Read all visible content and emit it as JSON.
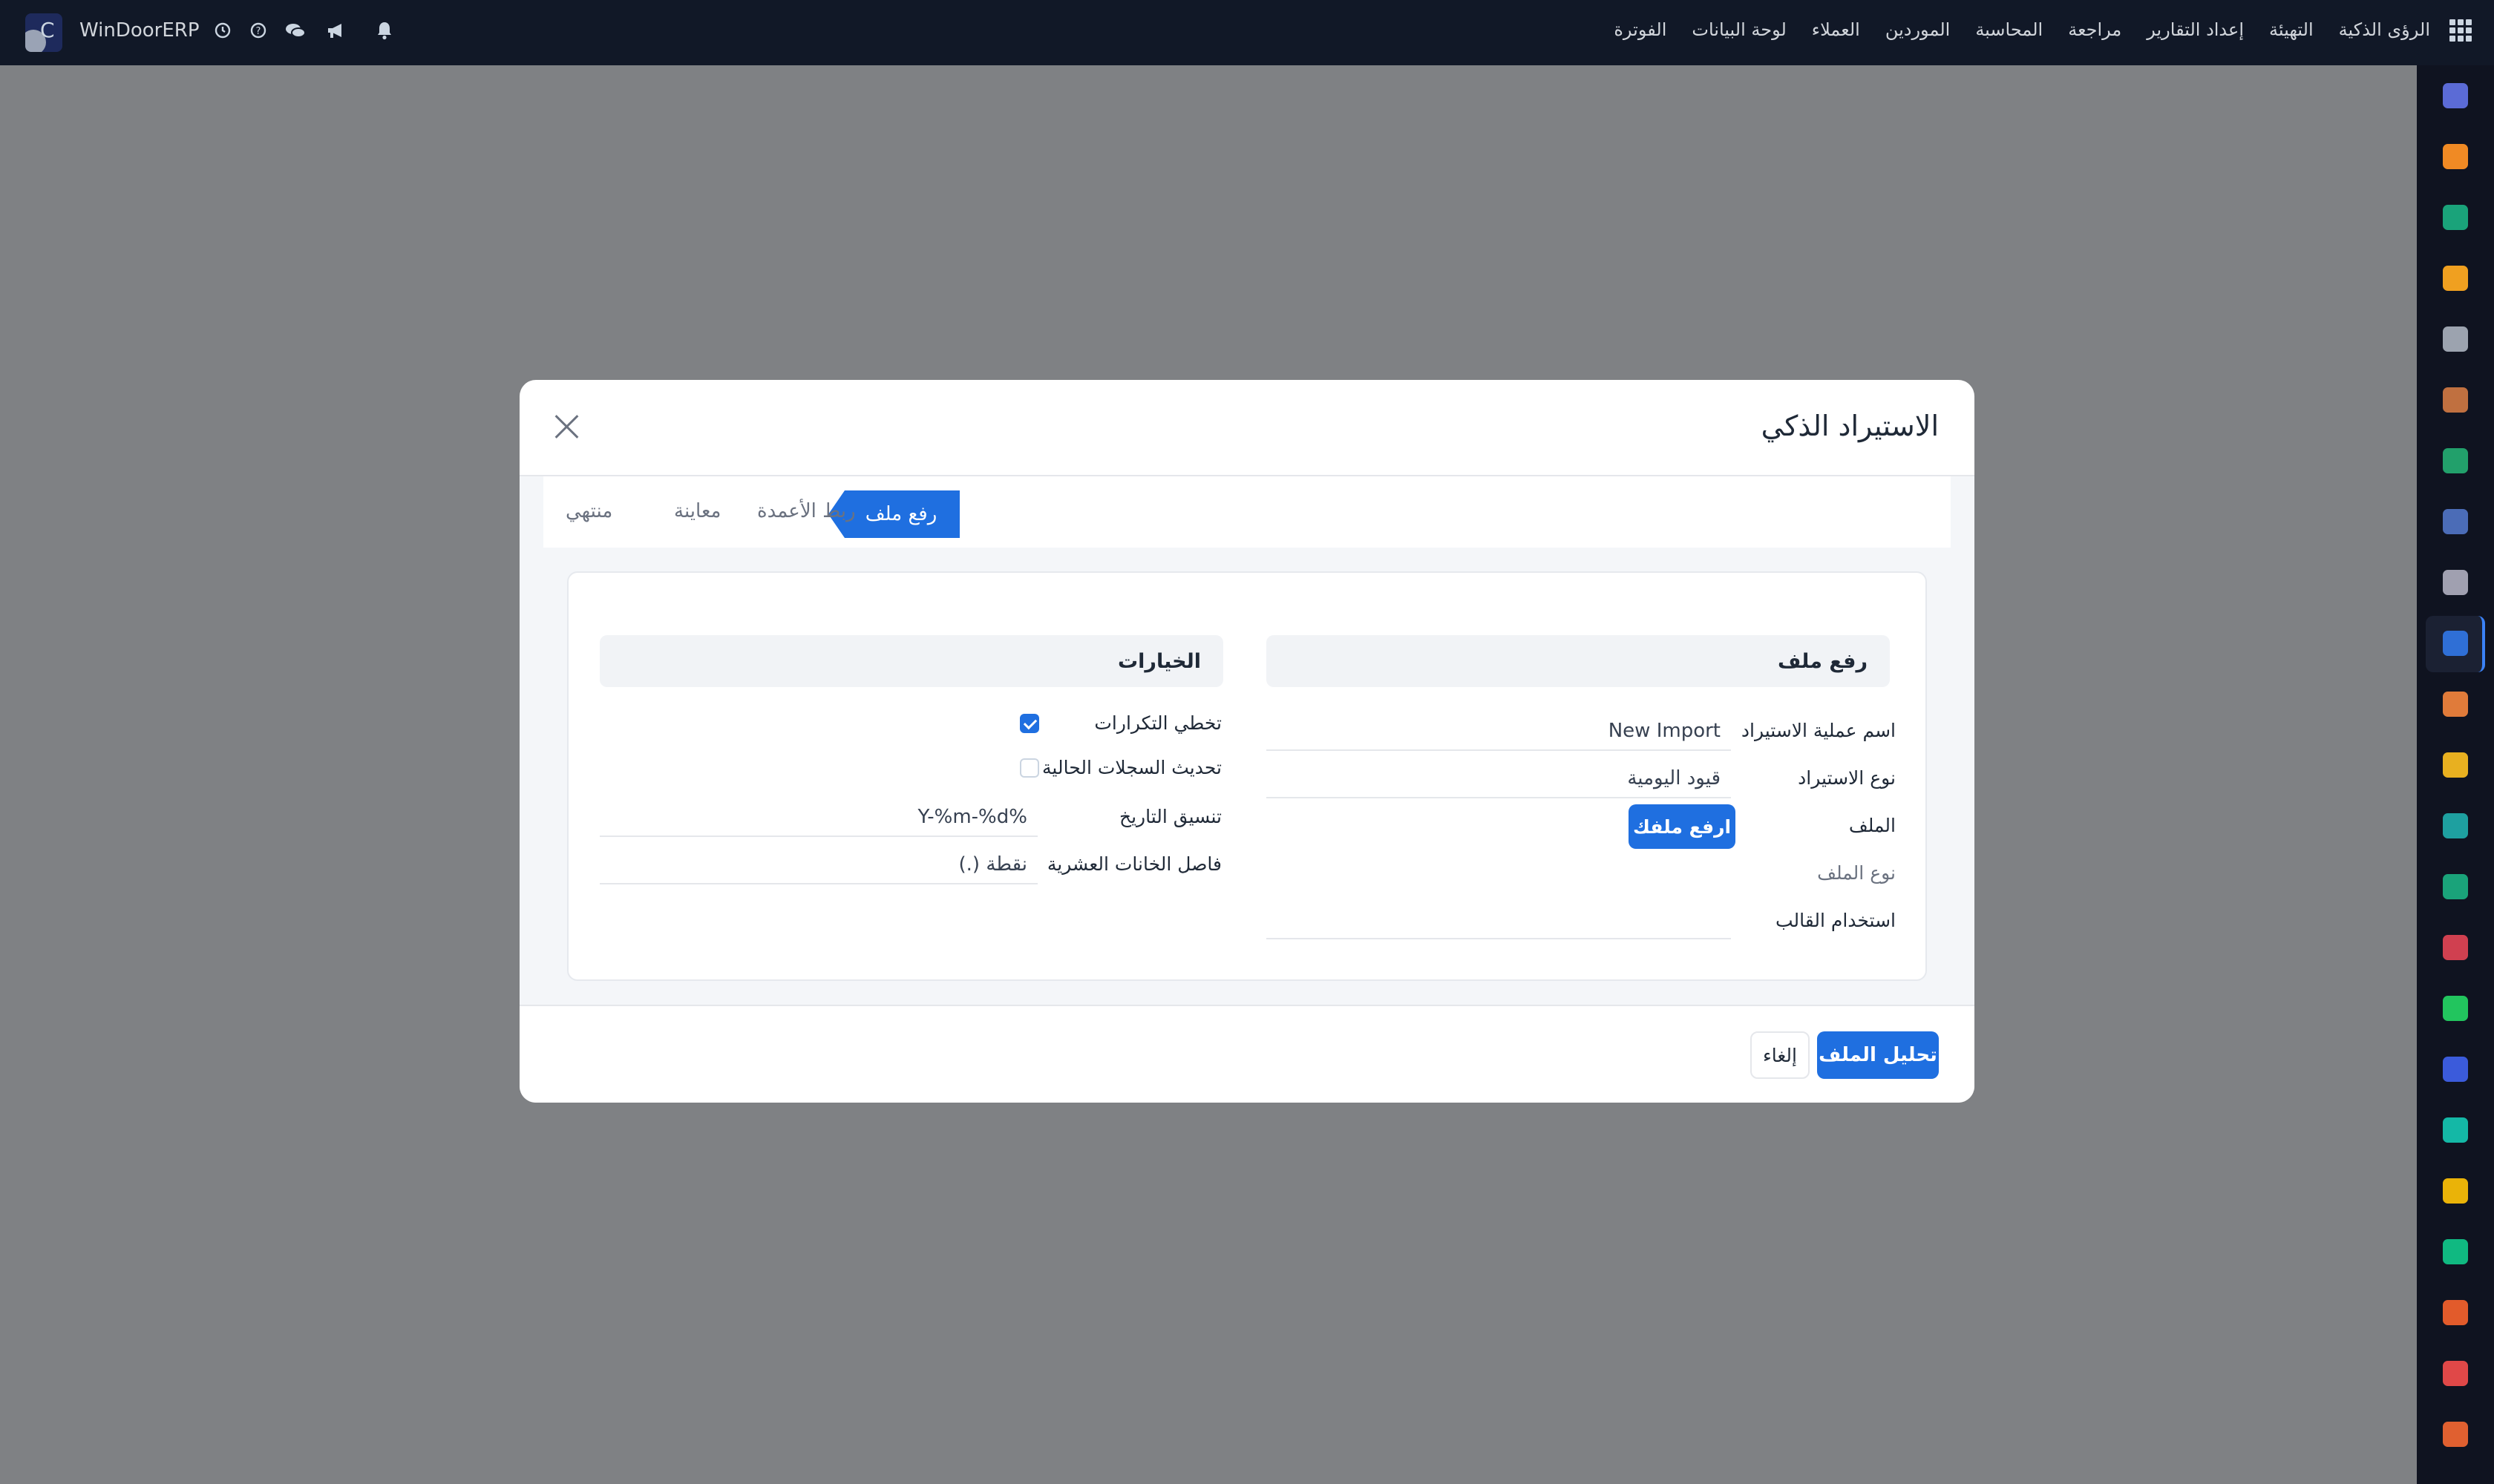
{
  "navbar": {
    "brand": "WinDoorERP",
    "menu": [
      "الفوترة",
      "لوحة البيانات",
      "العملاء",
      "الموردين",
      "المحاسبة",
      "مراجعة",
      "إعداد التقارير",
      "التهيئة",
      "الرؤى الذكية"
    ],
    "icons": [
      "clock-icon",
      "help-icon",
      "chat-icon",
      "megaphone-icon",
      "bell-icon",
      "apps-grid-icon"
    ]
  },
  "sidebar": {
    "icons": [
      {
        "name": "mail-app-icon",
        "color": "#5b6bd6"
      },
      {
        "name": "chat-app-icon",
        "color": "#f08a24"
      },
      {
        "name": "discuss-app-icon",
        "color": "#1aa37a"
      },
      {
        "name": "reports-app-icon",
        "color": "#f0a020"
      },
      {
        "name": "inventory-app-icon",
        "color": "#9ca3af"
      },
      {
        "name": "contacts-app-icon",
        "color": "#c07040"
      },
      {
        "name": "tasks-app-icon",
        "color": "#22a06b"
      },
      {
        "name": "messages-app-icon",
        "color": "#4b6cb7"
      },
      {
        "name": "products-app-icon",
        "color": "#a0a0b0"
      },
      {
        "name": "import-app-icon",
        "color": "#2f6fd6"
      },
      {
        "name": "employees-app-icon",
        "color": "#e07b3a"
      },
      {
        "name": "calendar-app-icon",
        "color": "#e8b020"
      },
      {
        "name": "sign-app-icon",
        "color": "#1ea0a0"
      },
      {
        "name": "hr-app-icon",
        "color": "#1aa37a"
      },
      {
        "name": "dashboard-app-icon",
        "color": "#d04050"
      },
      {
        "name": "whatsapp-app-icon",
        "color": "#22c55e"
      },
      {
        "name": "time-app-icon",
        "color": "#3b5bdb"
      },
      {
        "name": "planning-app-icon",
        "color": "#14b8a6"
      },
      {
        "name": "send-app-icon",
        "color": "#eab308"
      },
      {
        "name": "data-app-icon",
        "color": "#10b981"
      },
      {
        "name": "modules-app-icon",
        "color": "#e25b2b"
      },
      {
        "name": "analytics-app-icon",
        "color": "#e04848"
      },
      {
        "name": "settings-app-icon",
        "color": "#e06030"
      }
    ],
    "active_index": 9
  },
  "modal": {
    "title": "الاستيراد الذكي",
    "steps": {
      "upload": "رفع ملف",
      "mapping": "ربط الأعمدة",
      "preview": "معاينة",
      "done": "منتهي"
    },
    "upload_section": {
      "title": "رفع ملف",
      "import_name_label": "اسم عملية الاستيراد",
      "import_name_value": "New Import",
      "import_type_label": "نوع الاستيراد",
      "import_type_value": "قيود اليومية",
      "file_label": "الملف",
      "upload_button": "ارفع ملفك",
      "file_type_label": "نوع الملف",
      "use_template_label": "استخدام القالب"
    },
    "options_section": {
      "title": "الخيارات",
      "skip_duplicates_label": "تخطي التكرارات",
      "skip_duplicates_checked": true,
      "update_existing_label": "تحديث السجلات الحالية",
      "update_existing_checked": false,
      "date_format_label": "تنسيق التاريخ",
      "date_format_value": "%Y-%m-%d",
      "decimal_separator_label": "فاصل الخانات العشرية",
      "decimal_separator_value": "نقطة (.)"
    },
    "footer": {
      "analyze_button": "تحليل الملف",
      "cancel_button": "إلغاء"
    }
  }
}
